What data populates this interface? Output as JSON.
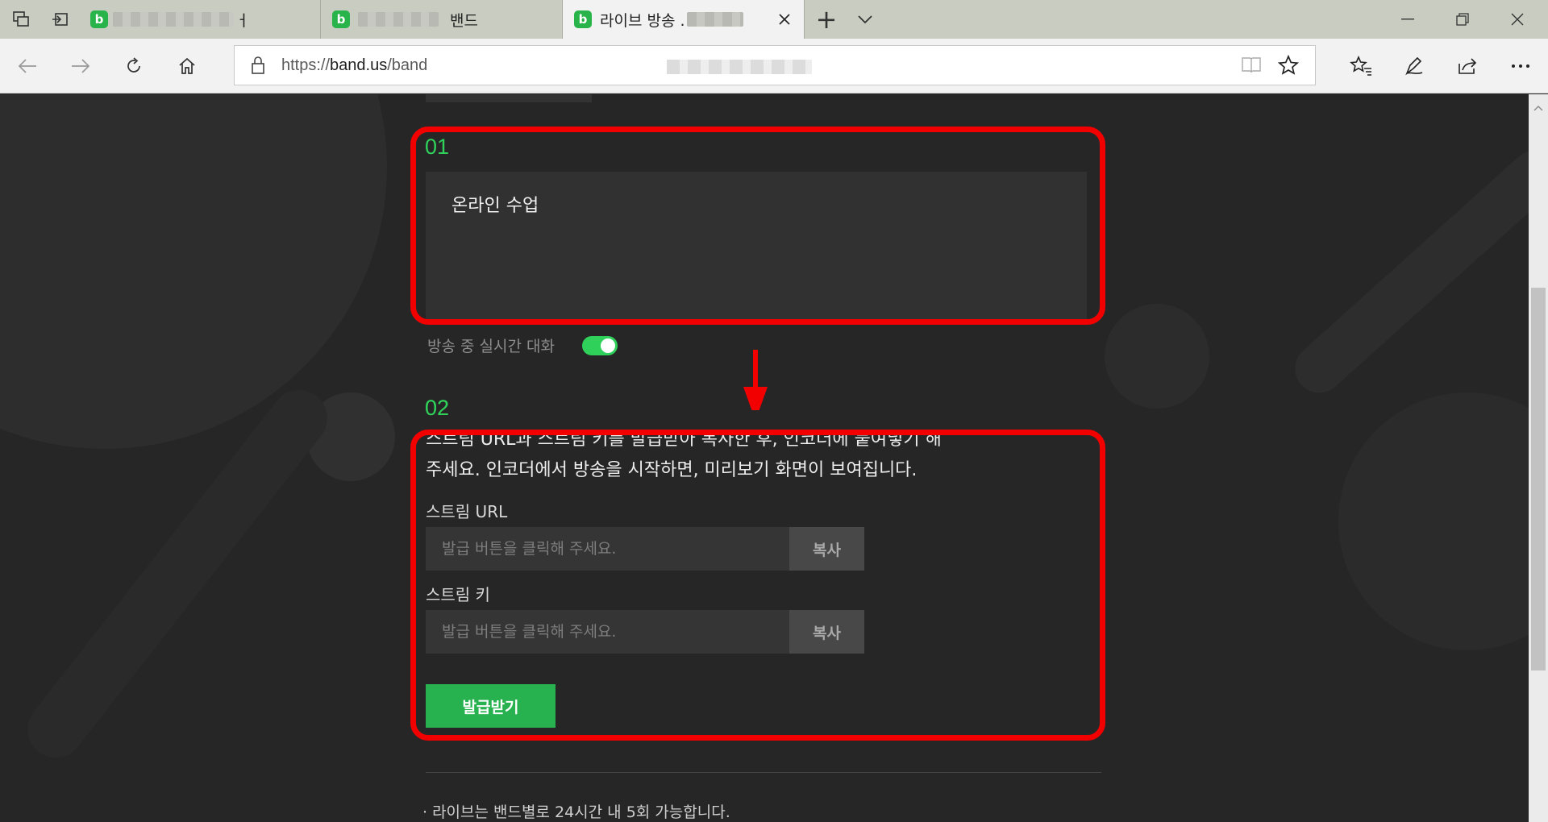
{
  "browser": {
    "tabs": [
      {
        "title": "ㅓ",
        "blurred": true
      },
      {
        "title": "밴드",
        "blurred": true
      },
      {
        "title": "라이브 방송 .",
        "blurred": true,
        "active": true
      }
    ],
    "favicon_letter": "b",
    "url_prefix": "https://",
    "url_host": "band.us",
    "url_path": "/band",
    "new_tab_symbol": "+"
  },
  "content": {
    "section1_number": "01",
    "live_title_value": "온라인 수업",
    "chat_toggle_label": "방송 중 실시간 대화",
    "chat_toggle_on": true,
    "section2_number": "02",
    "description_line1": "스트림 URL과 스트림 키를 발급받아 복사한 후, 인코더에 붙여넣기 해",
    "description_line2": "주세요. 인코더에서 방송을 시작하면, 미리보기 화면이 보여집니다.",
    "stream_url_label": "스트림 URL",
    "stream_url_placeholder": "발급 버튼을 클릭해 주세요.",
    "stream_key_label": "스트림 키",
    "stream_key_placeholder": "발급 버튼을 클릭해 주세요.",
    "copy_label": "복사",
    "issue_button_label": "발급받기",
    "note": "· 라이브는 밴드별로 24시간 내 5회 가능합니다."
  },
  "colors": {
    "accent_green": "#2fd15b",
    "button_green": "#27b24f",
    "highlight_red": "#f20000",
    "page_background": "#262626"
  },
  "icons": [
    "tab-group-icon",
    "set-aside-tabs-icon",
    "close-icon",
    "new-tab-icon",
    "chevron-down-icon",
    "minimize-icon",
    "restore-icon",
    "back-icon",
    "forward-icon",
    "refresh-icon",
    "home-icon",
    "lock-icon",
    "reading-view-icon",
    "favorite-star-icon",
    "favorites-hub-icon",
    "pen-icon",
    "share-icon",
    "more-icon",
    "arrow-down-icon"
  ]
}
